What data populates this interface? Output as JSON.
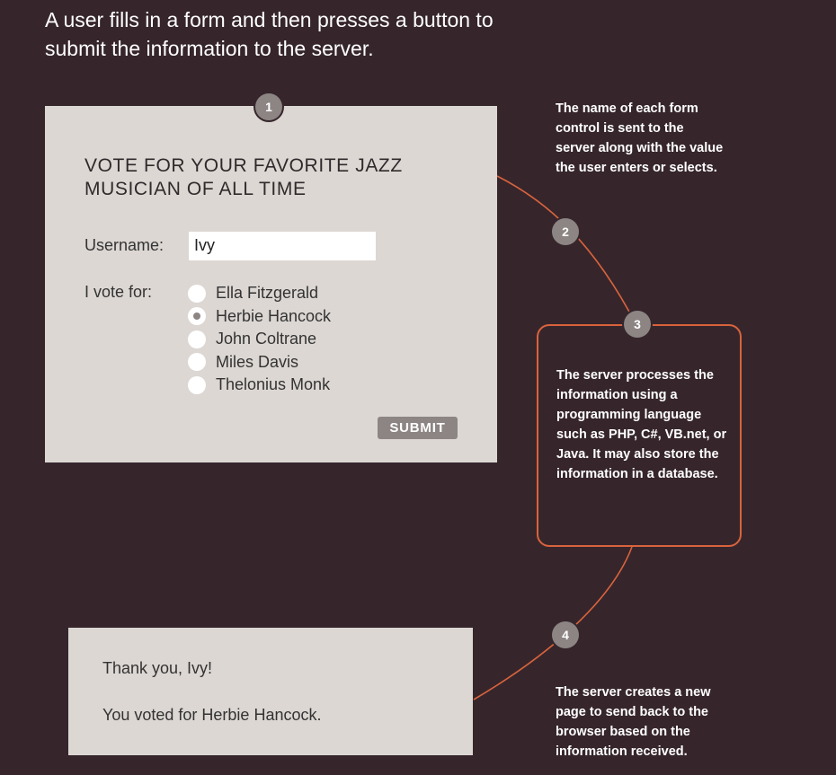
{
  "intro": "A user fills in a form and then presses a button to submit the information to the server.",
  "steps": [
    "1",
    "2",
    "3",
    "4"
  ],
  "form": {
    "heading": "VOTE FOR YOUR FAVORITE JAZZ MUSICIAN OF ALL TIME",
    "username_label": "Username:",
    "username_value": "Ivy",
    "vote_label": "I vote for:",
    "options": [
      "Ella Fitzgerald",
      "Herbie Hancock",
      "John Coltrane",
      "Miles Davis",
      "Thelonius Monk"
    ],
    "selected_option": "Herbie Hancock",
    "submit_label": "SUBMIT"
  },
  "annotations": {
    "step2": "The name of each form control is sent to the server along with the value the user enters or selects.",
    "step3": "The server processes the information using a programming language such as PHP, C#, VB.net, or Java. It may also store the information in a database.",
    "step4": "The server creates a new page to send back to the browser based on the information received."
  },
  "result": {
    "thank_you": "Thank you, Ivy!",
    "voted_for": "You voted for Herbie Hancock."
  },
  "colors": {
    "background": "#36262c",
    "panel": "#dcd7d3",
    "accent": "#d9633c",
    "badge": "#8c8584"
  }
}
